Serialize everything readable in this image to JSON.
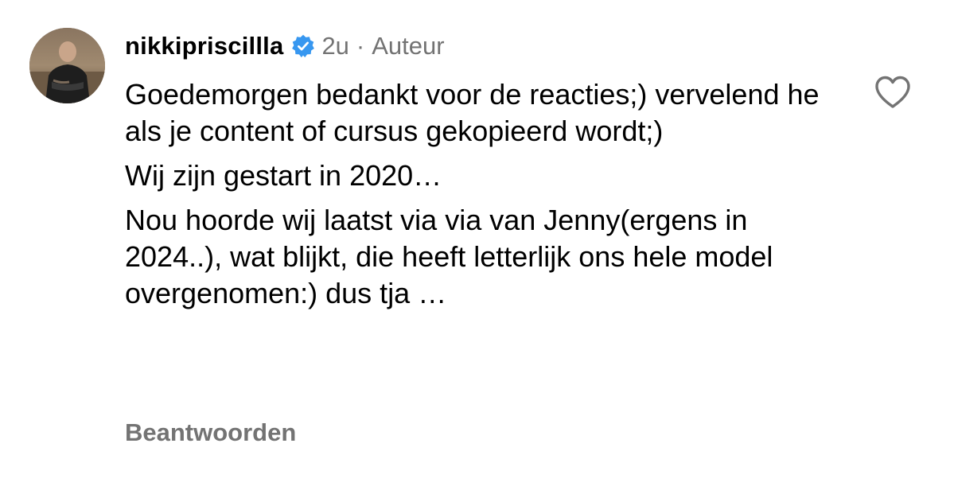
{
  "comment": {
    "username": "nikkipriscillla",
    "verified_icon": "verified-badge-icon",
    "time": "2u",
    "separator": "·",
    "role": "Auteur",
    "paragraphs": [
      "Goedemorgen bedankt voor de reacties;) vervelend he als je content of cursus gekopieerd wordt;)",
      "Wij zijn gestart in 2020…",
      "Nou hoorde wij laatst via via van Jenny(ergens in 2024..), wat blijkt, die heeft letterlijk ons hele model overgenomen:) dus tja …"
    ],
    "reply_label": "Beantwoorden",
    "like_icon": "heart-outline-icon"
  },
  "colors": {
    "verified_blue": "#3797F0",
    "secondary_text": "#737373"
  }
}
